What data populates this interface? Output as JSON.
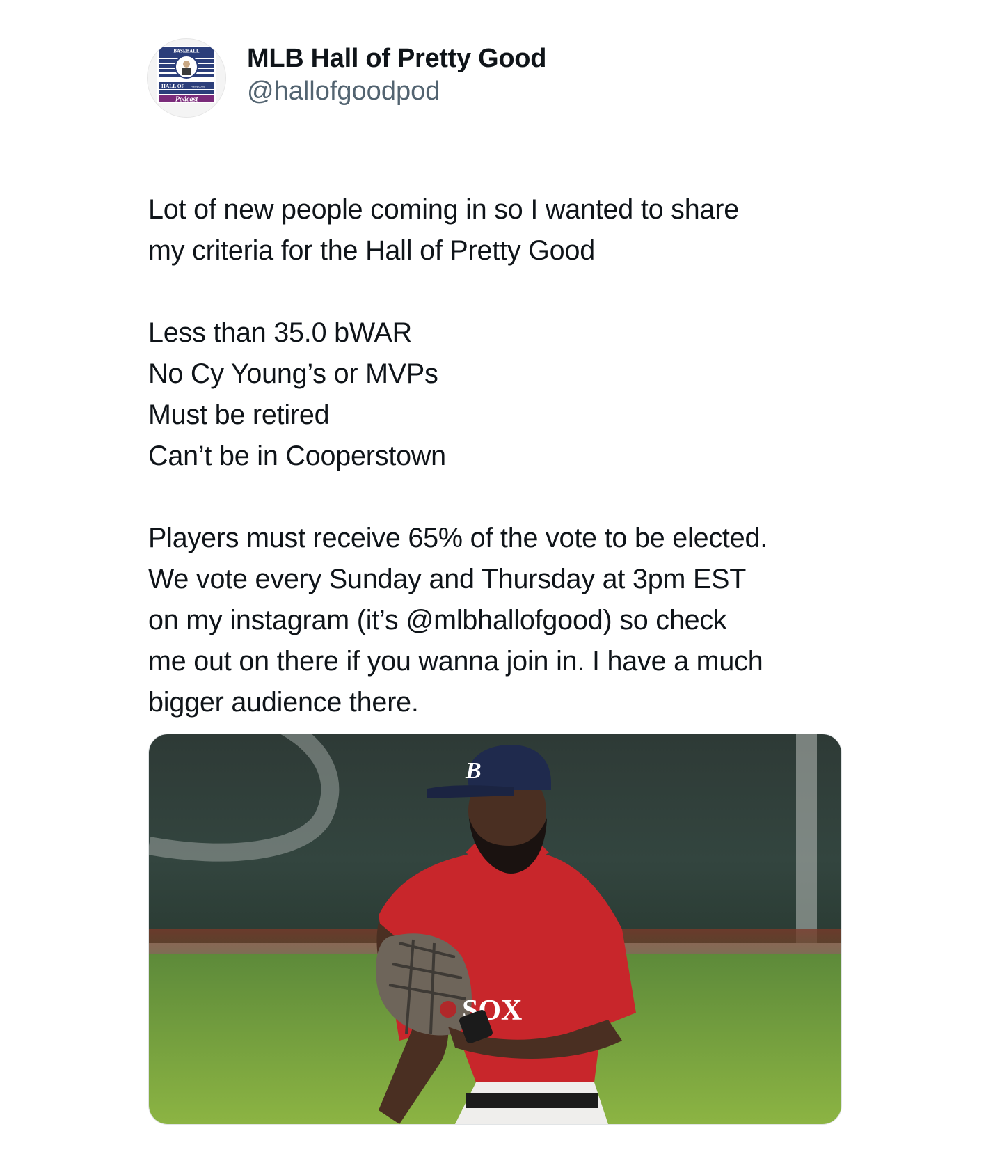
{
  "tweet": {
    "display_name": "MLB Hall of Pretty Good",
    "handle": "@hallofgoodpod",
    "avatar": {
      "icon": "hall-of-pretty-good-podcast-logo",
      "top_text": "BASEBALL",
      "mid_text": "HALL OF",
      "small_text": "Pretty good",
      "bottom_text": "Podcast"
    },
    "paragraphs": [
      {
        "lines": [
          "Lot of new people coming in so I wanted to share",
          "my criteria for the Hall of Pretty Good"
        ]
      },
      {
        "lines": [
          "Less than 35.0 bWAR",
          "No Cy Young’s or MVPs",
          "Must be retired",
          "Can’t be in Cooperstown"
        ]
      },
      {
        "lines": [
          "Players must receive 65% of the vote to be elected.",
          "We vote every Sunday and Thursday at 3pm EST",
          "on my instagram (it’s @mlbhallofgood) so check",
          "me out on there if you wanna join in. I have a much",
          "bigger audience there."
        ]
      }
    ],
    "media": {
      "cap_letter": "B",
      "jersey_text": "SOX"
    }
  }
}
